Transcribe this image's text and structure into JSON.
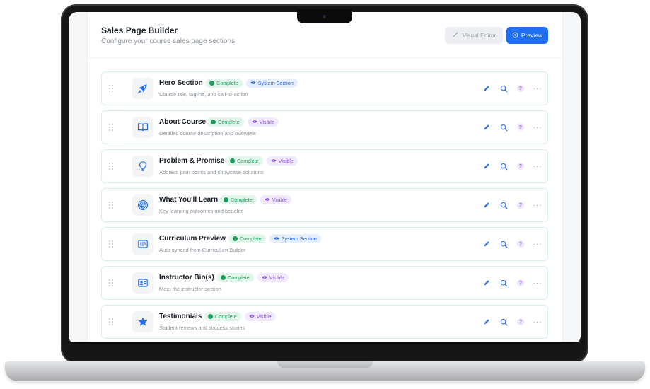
{
  "header": {
    "title": "Sales Page Builder",
    "subtitle": "Configure your course sales page sections",
    "visual_editor_label": "Visual Editor",
    "preview_label": "Preview"
  },
  "colors": {
    "primary": "#1f6ff0",
    "complete_bg": "#e3f6ec",
    "complete_text": "#1e9b5a",
    "system_bg": "#e6efff",
    "system_text": "#2563d9",
    "visible_bg": "#f1eafe",
    "visible_text": "#8b4fd6"
  },
  "sections": [
    {
      "title": "Hero Section",
      "description": "Course title, tagline, and call-to-action",
      "status": "Complete",
      "visibility": "System Section",
      "icon": "rocket-icon"
    },
    {
      "title": "About Course",
      "description": "Detailed course description and overview",
      "status": "Complete",
      "visibility": "Visible",
      "icon": "book-icon"
    },
    {
      "title": "Problem & Promise",
      "description": "Address pain points and showcase solutions",
      "status": "Complete",
      "visibility": "Visible",
      "icon": "lightbulb-icon"
    },
    {
      "title": "What You'll Learn",
      "description": "Key learning outcomes and benefits",
      "status": "Complete",
      "visibility": "Visible",
      "icon": "target-icon"
    },
    {
      "title": "Curriculum Preview",
      "description": "Auto-synced from Curriculum Builder",
      "status": "Complete",
      "visibility": "System Section",
      "icon": "list-card-icon"
    },
    {
      "title": "Instructor Bio(s)",
      "description": "Meet the instructor section",
      "status": "Complete",
      "visibility": "Visible",
      "icon": "profile-card-icon"
    },
    {
      "title": "Testimonials",
      "description": "Student reviews and success stories",
      "status": "Complete",
      "visibility": "Visible",
      "icon": "star-icon"
    }
  ],
  "actions": {
    "help_label": "?",
    "more_label": "···"
  }
}
